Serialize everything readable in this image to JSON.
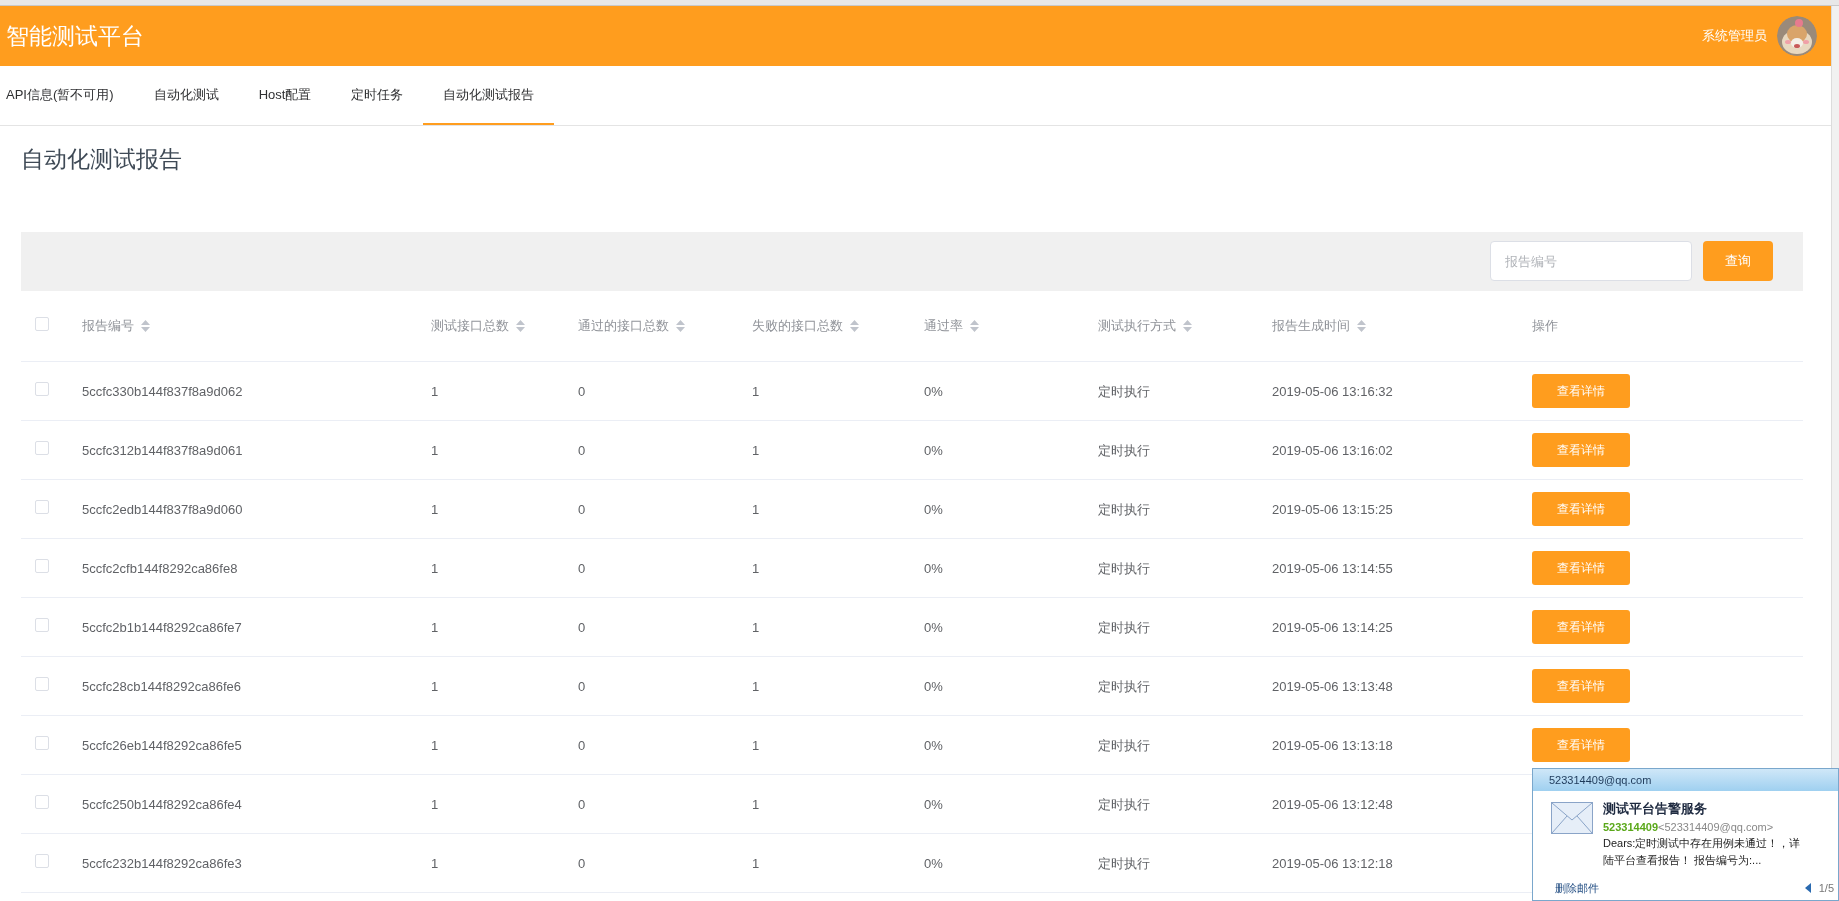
{
  "header": {
    "title": "智能测试平台",
    "user": "系统管理员"
  },
  "tabs": [
    {
      "label": "API信息(暂不可用)",
      "selected": false
    },
    {
      "label": "自动化测试",
      "selected": false
    },
    {
      "label": "Host配置",
      "selected": false
    },
    {
      "label": "定时任务",
      "selected": false
    },
    {
      "label": "自动化测试报告",
      "selected": true
    }
  ],
  "page_title": "自动化测试报告",
  "search": {
    "placeholder": "报告编号",
    "button": "查询"
  },
  "table": {
    "select_all_checked": false,
    "columns": [
      {
        "label": "报告编号",
        "sortable": true
      },
      {
        "label": "测试接口总数",
        "sortable": true
      },
      {
        "label": "通过的接口总数",
        "sortable": true
      },
      {
        "label": "失败的接口总数",
        "sortable": true
      },
      {
        "label": "通过率",
        "sortable": true
      },
      {
        "label": "测试执行方式",
        "sortable": true
      },
      {
        "label": "报告生成时间",
        "sortable": true
      },
      {
        "label": "操作",
        "sortable": false
      }
    ],
    "rows": [
      {
        "checked": false,
        "cells": [
          "5ccfc330b144f837f8a9d062",
          "1",
          "0",
          "1",
          "0%",
          "定时执行",
          "2019-05-06 13:16:32"
        ],
        "action": "查看详情"
      },
      {
        "checked": false,
        "cells": [
          "5ccfc312b144f837f8a9d061",
          "1",
          "0",
          "1",
          "0%",
          "定时执行",
          "2019-05-06 13:16:02"
        ],
        "action": "查看详情"
      },
      {
        "checked": false,
        "cells": [
          "5ccfc2edb144f837f8a9d060",
          "1",
          "0",
          "1",
          "0%",
          "定时执行",
          "2019-05-06 13:15:25"
        ],
        "action": "查看详情"
      },
      {
        "checked": false,
        "cells": [
          "5ccfc2cfb144f8292ca86fe8",
          "1",
          "0",
          "1",
          "0%",
          "定时执行",
          "2019-05-06 13:14:55"
        ],
        "action": "查看详情"
      },
      {
        "checked": false,
        "cells": [
          "5ccfc2b1b144f8292ca86fe7",
          "1",
          "0",
          "1",
          "0%",
          "定时执行",
          "2019-05-06 13:14:25"
        ],
        "action": "查看详情"
      },
      {
        "checked": false,
        "cells": [
          "5ccfc28cb144f8292ca86fe6",
          "1",
          "0",
          "1",
          "0%",
          "定时执行",
          "2019-05-06 13:13:48"
        ],
        "action": "查看详情"
      },
      {
        "checked": false,
        "cells": [
          "5ccfc26eb144f8292ca86fe5",
          "1",
          "0",
          "1",
          "0%",
          "定时执行",
          "2019-05-06 13:13:18"
        ],
        "action": "查看详情"
      },
      {
        "checked": false,
        "cells": [
          "5ccfc250b144f8292ca86fe4",
          "1",
          "0",
          "1",
          "0%",
          "定时执行",
          "2019-05-06 13:12:48"
        ]
      },
      {
        "checked": false,
        "cells": [
          "5ccfc232b144f8292ca86fe3",
          "1",
          "0",
          "1",
          "0%",
          "定时执行",
          "2019-05-06 13:12:18"
        ]
      }
    ]
  },
  "notification": {
    "account": "523314409@qq.com",
    "subject": "测试平台告警服务",
    "sender_name": "523314409",
    "sender_address": "<523314409@qq.com>",
    "body_lines": [
      "Dears:定时测试中存在用例未通过！，详",
      "陆平台查看报告！ 报告编号为:..."
    ],
    "delete": "删除邮件",
    "counter": "1/5"
  }
}
